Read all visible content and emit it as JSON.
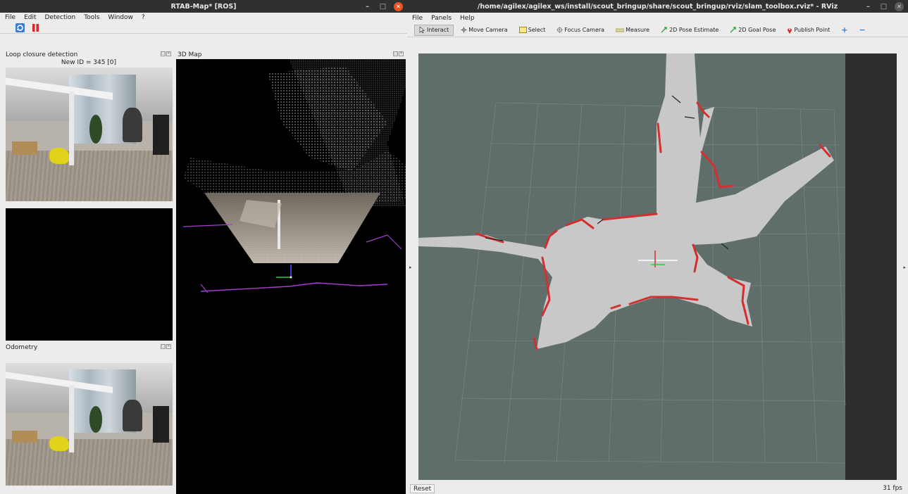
{
  "rtabmap": {
    "title": "RTAB-Map* [ROS]",
    "window_controls": {
      "minimize": "–",
      "maximize": "□",
      "close": "✕"
    },
    "menu": [
      "File",
      "Edit",
      "Detection",
      "Tools",
      "Window",
      "?"
    ],
    "toolbar_icons": [
      "refresh-icon",
      "pause-icon"
    ],
    "loop_closure_panel": {
      "title": "Loop closure detection",
      "subtitle": "New ID = 345 [0]"
    },
    "map_panel": {
      "title": "3D Map"
    },
    "odometry_panel": {
      "title": "Odometry"
    },
    "dock_buttons": [
      "□",
      "✕"
    ]
  },
  "rviz": {
    "title": "/home/agilex/agilex_ws/install/scout_bringup/share/scout_bringup/rviz/slam_toolbox.rviz* - RViz",
    "window_controls": {
      "minimize": "–",
      "maximize": "□",
      "close": "✕"
    },
    "menu": [
      "File",
      "Panels",
      "Help"
    ],
    "tools": [
      {
        "label": "Interact",
        "icon": "cursor-icon",
        "active": true
      },
      {
        "label": "Move Camera",
        "icon": "move-camera-icon",
        "active": false
      },
      {
        "label": "Select",
        "icon": "select-icon",
        "active": false
      },
      {
        "label": "Focus Camera",
        "icon": "focus-camera-icon",
        "active": false
      },
      {
        "label": "Measure",
        "icon": "ruler-icon",
        "active": false
      },
      {
        "label": "2D Pose Estimate",
        "icon": "pose-arrow-icon",
        "active": false
      },
      {
        "label": "2D Goal Pose",
        "icon": "goal-arrow-icon",
        "active": false
      },
      {
        "label": "Publish Point",
        "icon": "map-pin-icon",
        "active": false
      }
    ],
    "extra_tools": [
      "+",
      "−"
    ],
    "reset_label": "Reset",
    "fps": "31 fps",
    "colors": {
      "grid_bg": "#5f6e6b",
      "free_space": "#c8c8c8",
      "obstacle": "#d32f2f",
      "grid_line": "#8a9895"
    }
  }
}
